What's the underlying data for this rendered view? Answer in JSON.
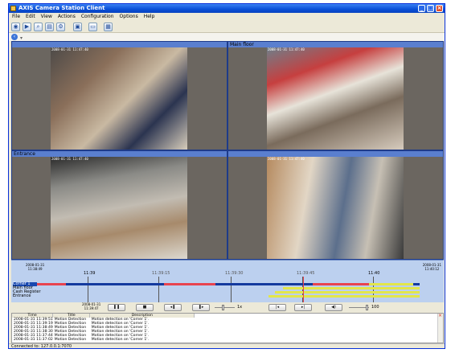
{
  "window": {
    "title": "AXIS Camera Station Client"
  },
  "menu": [
    "File",
    "Edit",
    "View",
    "Actions",
    "Configuration",
    "Options",
    "Help"
  ],
  "toolbar": {
    "icons": [
      "live-view-icon",
      "playback-icon",
      "search-icon",
      "export-icon",
      "settings-icon",
      "camera-icon",
      "monitor-icon",
      "layout-icon"
    ]
  },
  "views": [
    {
      "title": "",
      "stamp": "2008-01-31 11:47:40"
    },
    {
      "title": "Main floor",
      "stamp": "2008-01-31 11:47:40"
    },
    {
      "title": "Entrance",
      "stamp": "2008-01-31 11:47:40"
    },
    {
      "title": "",
      "stamp": "2008-01-31 11:47:40"
    }
  ],
  "timeline": {
    "start": {
      "date": "2008-01-31",
      "time": "11:38:49"
    },
    "end": {
      "date": "2008-01-31",
      "time": "11:40:12"
    },
    "ticks": [
      "11:39",
      "11:39:15",
      "11:39:30",
      "11:39:45",
      "11:40"
    ],
    "rows": [
      "Corner 1",
      "Main floor",
      "Cash Register",
      "Entrance"
    ],
    "cursor": {
      "date": "2008-01-31",
      "time": "11:39:47"
    }
  },
  "playback": {
    "speed_label": "1x",
    "volume_label": "100"
  },
  "log": {
    "columns": [
      "Time",
      "Title",
      "Description"
    ],
    "rows": [
      [
        "2008-01-31 11:39:51",
        "Motion Detection",
        "Motion detection on 'Corner 1'."
      ],
      [
        "2008-01-31 11:39:19",
        "Motion Detection",
        "Motion detection on 'Corner 1'."
      ],
      [
        "2008-01-31 11:38:49",
        "Motion Detection",
        "Motion detection on 'Corner 1'."
      ],
      [
        "2008-01-31 11:38:30",
        "Motion Detection",
        "Motion detection on 'Corner 1'."
      ],
      [
        "2008-01-31 11:37:44",
        "Motion Detection",
        "Motion detection on 'Corner 1'."
      ],
      [
        "2008-01-31 11:37:02",
        "Motion Detection",
        "Motion detection on 'Corner 1'."
      ]
    ]
  },
  "status": "Connected to: 127.0.0.1:7070",
  "colors": {
    "accent": "#0a4fd7",
    "recording_motion": "#e8434f",
    "recording_continuous": "#e2e64a"
  }
}
